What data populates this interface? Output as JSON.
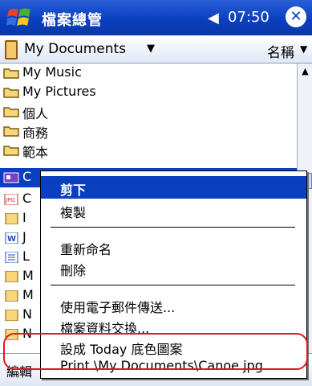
{
  "titlebar": {
    "app_title": "檔案總管",
    "volume_icon": "speaker-icon",
    "time": "07:50",
    "close_label": "✕"
  },
  "pathbar": {
    "folder": "My Documents",
    "sort": "名稱"
  },
  "files": [
    {
      "name": "My Music",
      "icon": "folder"
    },
    {
      "name": "My Pictures",
      "icon": "folder"
    },
    {
      "name": "個人",
      "icon": "folder"
    },
    {
      "name": "商務",
      "icon": "folder"
    },
    {
      "name": "範本",
      "icon": "folder"
    },
    {
      "name": "C",
      "icon": "image",
      "selected": true
    },
    {
      "name": "C",
      "icon": "jpg"
    },
    {
      "name": "I",
      "icon": "note"
    },
    {
      "name": "J",
      "icon": "word"
    },
    {
      "name": "L",
      "icon": "doc"
    },
    {
      "name": "M",
      "icon": "note"
    },
    {
      "name": "M",
      "icon": "note"
    },
    {
      "name": "N",
      "icon": "note"
    },
    {
      "name": "N",
      "icon": "note"
    }
  ],
  "bottombar": {
    "edit_label": "編輯"
  },
  "context_menu": {
    "cut": "剪下",
    "copy": "複製",
    "rename": "重新命名",
    "delete": "刪除",
    "send_email": "使用電子郵件傳送...",
    "beam": "檔案資料交換...",
    "set_today_bg": "設成 Today 底色圖案",
    "print": "Print \\My Documents\\Canoe.jpg"
  },
  "colors": {
    "accent": "#0a3fbf",
    "highlight_outline": "#e0191b"
  }
}
